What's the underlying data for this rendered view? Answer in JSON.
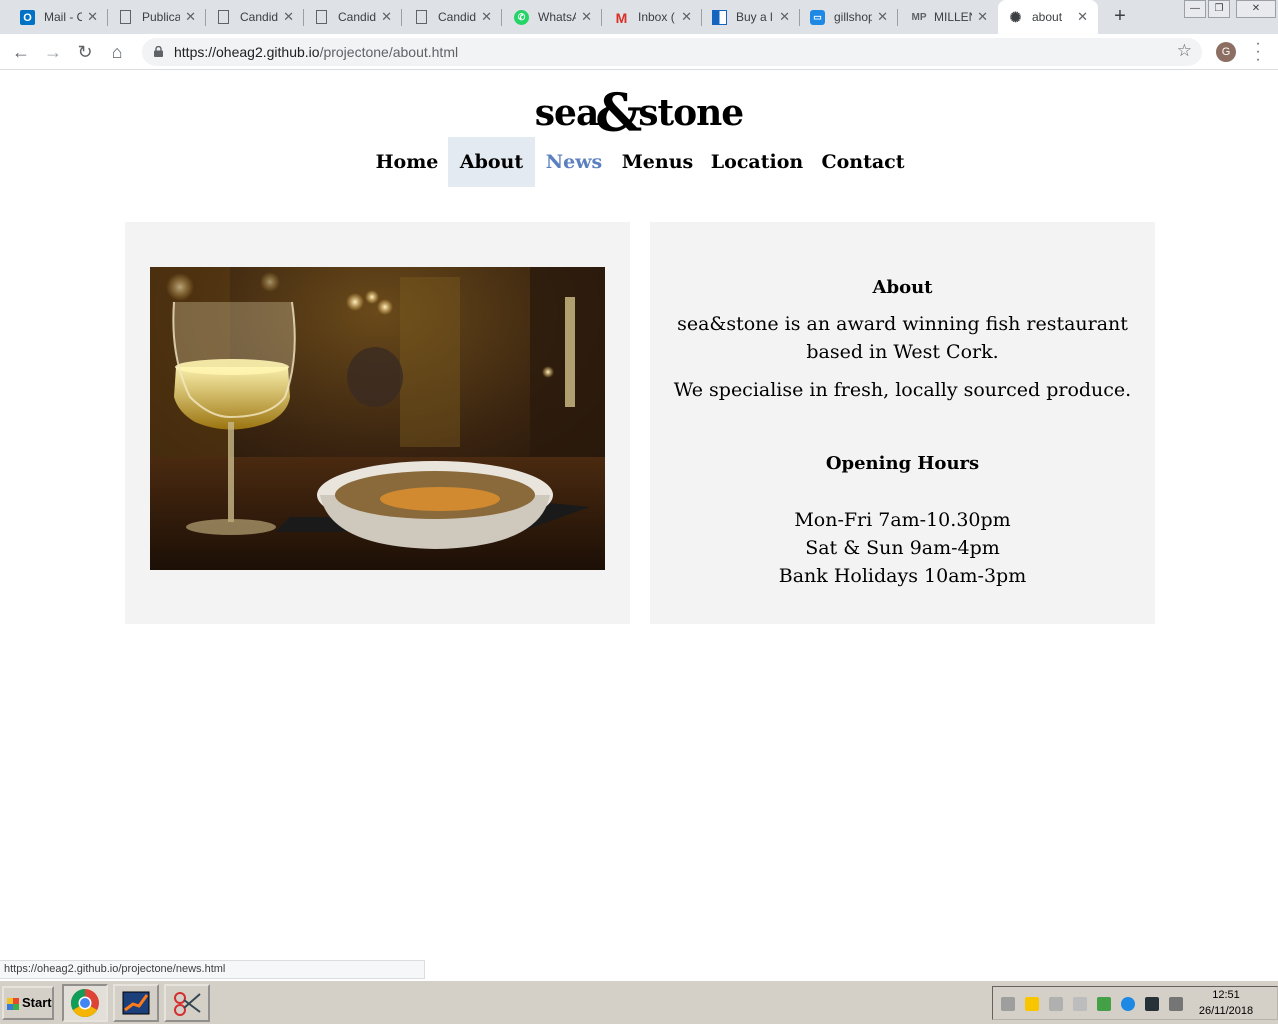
{
  "browser": {
    "tabs": [
      {
        "label": "Mail - O",
        "icon": "outlook-icon",
        "color": "#0072c6"
      },
      {
        "label": "Publica",
        "icon": "document-icon",
        "color": "#5f6368"
      },
      {
        "label": "Candid",
        "icon": "document-icon",
        "color": "#5f6368"
      },
      {
        "label": "Candid",
        "icon": "document-icon",
        "color": "#5f6368"
      },
      {
        "label": "Candid",
        "icon": "document-icon",
        "color": "#5f6368"
      },
      {
        "label": "WhatsA",
        "icon": "whatsapp-icon",
        "color": "#25d366"
      },
      {
        "label": "Inbox (",
        "icon": "gmail-icon",
        "color": "#d93025"
      },
      {
        "label": "Buy a l",
        "icon": "store-icon",
        "color": "#1565c0"
      },
      {
        "label": "gillshop",
        "icon": "shop-icon",
        "color": "#1e88e5"
      },
      {
        "label": "MILLEN",
        "icon": "mp-icon",
        "color": "#5f6368"
      },
      {
        "label": "about",
        "icon": "crab-icon",
        "color": "#3c4043",
        "active": true
      }
    ],
    "new_tab": "+",
    "url_host": "https://oheag2.github.io",
    "url_path": "/projectone/about.html",
    "profile_initial": "G",
    "status_url": "https://oheag2.github.io/projectone/news.html"
  },
  "site": {
    "logo_left": "sea",
    "logo_amp": "&",
    "logo_right": "stone",
    "nav": [
      "Home",
      "About",
      "News",
      "Menus",
      "Location",
      "Contact"
    ],
    "active_nav": "About",
    "hover_nav": "News",
    "about_heading": "About",
    "about_p1": "sea&stone is an award winning fish restaurant based in West Cork.",
    "about_p2": "We specialise in fresh, locally sourced produce.",
    "hours_heading": "Opening Hours",
    "hours": [
      "Mon-Fri 7am-10.30pm",
      "Sat & Sun 9am-4pm",
      "Bank Holidays 10am-3pm"
    ],
    "accent_hover": "#5b7fbf",
    "active_bg": "#e3eaf2"
  },
  "taskbar": {
    "start_label": "Start",
    "time": "12:51",
    "date": "26/11/2018"
  }
}
